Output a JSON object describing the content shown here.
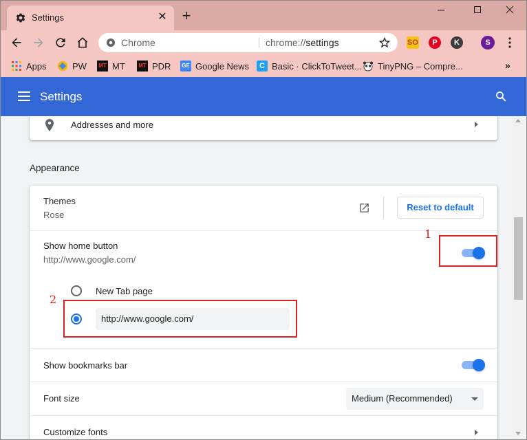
{
  "tab": {
    "title": "Settings"
  },
  "toolbar": {
    "omnibox_site": "Chrome",
    "omnibox_url_scheme": "chrome://",
    "omnibox_url_path": "settings",
    "profile_initial": "S",
    "ext_k_label": "K",
    "ext_so_label": "SO"
  },
  "bookmarks": [
    {
      "label": "Apps",
      "icon": "apps-grid-icon"
    },
    {
      "label": "PW",
      "icon": "pw-icon"
    },
    {
      "label": "MT",
      "icon": "mt-icon"
    },
    {
      "label": "PDR",
      "icon": "pdr-icon"
    },
    {
      "label": "Google News",
      "icon": "google-news-icon"
    },
    {
      "label": "Basic · ClickToTweet...",
      "icon": "clicktotweet-icon"
    },
    {
      "label": "TinyPNG – Compre...",
      "icon": "tinypng-icon"
    }
  ],
  "header": {
    "title": "Settings"
  },
  "autofill": {
    "addresses_label": "Addresses and more"
  },
  "appearance": {
    "section_title": "Appearance",
    "themes_label": "Themes",
    "themes_value": "Rose",
    "reset_button": "Reset to default",
    "home_button_label": "Show home button",
    "home_button_value": "http://www.google.com/",
    "home_button_enabled": true,
    "new_tab_option": "New Tab page",
    "custom_url_value": "http://www.google.com/",
    "bookmarks_bar_label": "Show bookmarks bar",
    "bookmarks_bar_enabled": true,
    "font_size_label": "Font size",
    "font_size_value": "Medium (Recommended)",
    "customize_fonts_label": "Customize fonts"
  },
  "annotations": {
    "marker_1": "1",
    "marker_2": "2"
  },
  "colors": {
    "title_bar": "#dcaaa5",
    "toolbar": "#f4c7c3",
    "header": "#3367d6",
    "accent": "#1a73e8",
    "annotation": "#e02020"
  }
}
